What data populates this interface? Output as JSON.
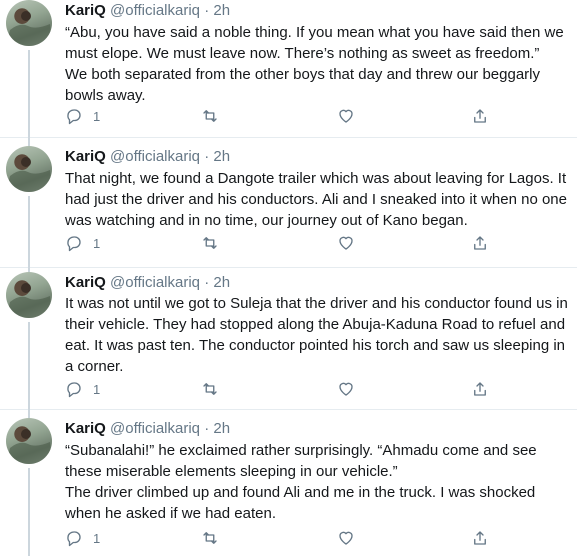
{
  "tweets": [
    {
      "name": "KariQ",
      "handle": "@officialkariq",
      "dot": "·",
      "time": "2h",
      "text": "“Abu, you have said a noble thing. If you mean what you have said then we must elope. We must leave now. There’s nothing as sweet as freedom.”\nWe both separated from the other boys that day and threw our beggarly bowls away.",
      "reply_count": "1"
    },
    {
      "name": "KariQ",
      "handle": "@officialkariq",
      "dot": "·",
      "time": "2h",
      "text": "That night, we found a Dangote trailer which was about leaving for Lagos. It had just the driver and his conductors. Ali and I sneaked into it when no one was watching and in no time, our journey out of Kano began.",
      "reply_count": "1"
    },
    {
      "name": "KariQ",
      "handle": "@officialkariq",
      "dot": "·",
      "time": "2h",
      "text": "It was not until we got to Suleja that the driver and his conductor found us in their vehicle. They had stopped along the Abuja-Kaduna Road to refuel and eat. It was past ten. The conductor pointed his torch and saw us sleeping in a corner.",
      "reply_count": "1"
    },
    {
      "name": "KariQ",
      "handle": "@officialkariq",
      "dot": "·",
      "time": "2h",
      "text": "“Subanalahi!” he exclaimed rather surprisingly. “Ahmadu come and see these miserable elements sleeping in our vehicle.”\nThe driver climbed up and found Ali and me in the truck. I was shocked when he asked if we had eaten.",
      "reply_count": "1"
    }
  ],
  "icons": {
    "reply": "reply-icon",
    "retweet": "retweet-icon",
    "like": "heart-icon",
    "share": "share-icon"
  },
  "colors": {
    "text": "#14171a",
    "secondary": "#657786",
    "divider": "#e6ecf0",
    "thread": "#ccd6dd"
  }
}
